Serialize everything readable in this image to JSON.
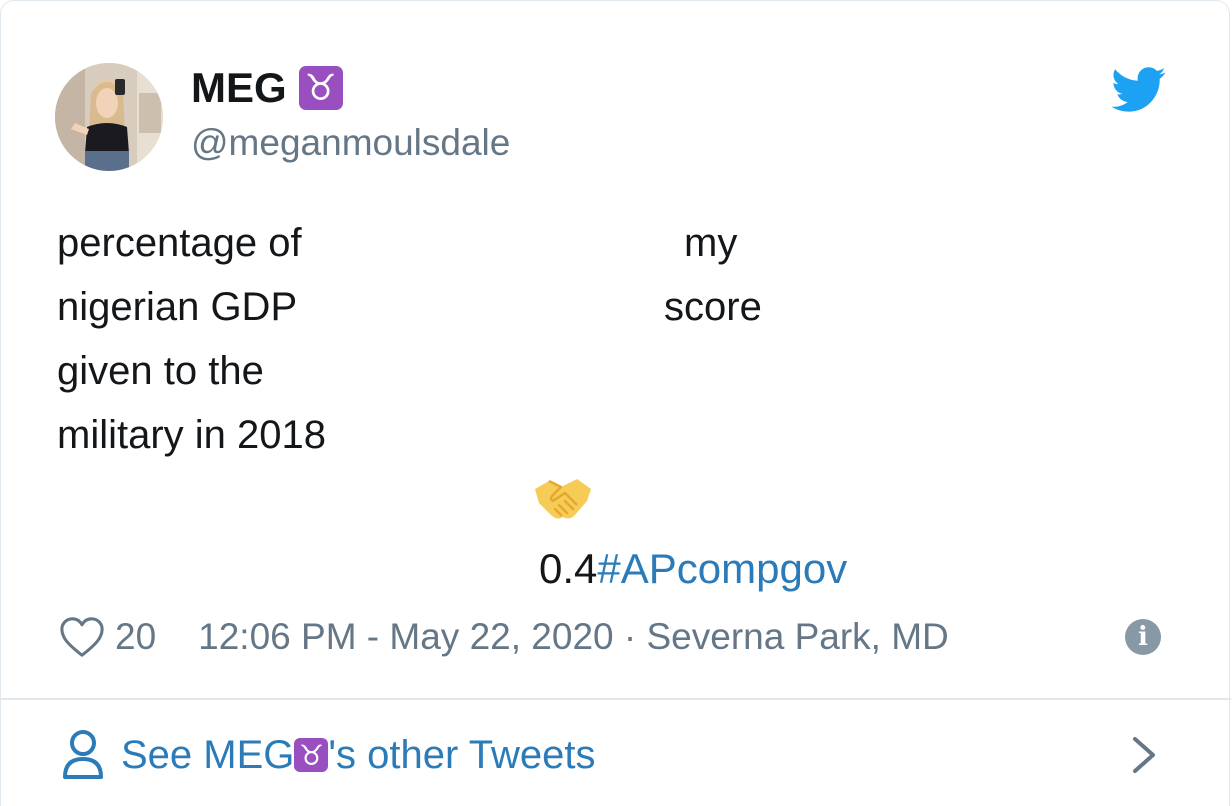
{
  "author": {
    "name": "MEG",
    "zodiac_emoji": "♉",
    "handle": "@meganmoulsdale"
  },
  "tweet": {
    "left_column": [
      "percentage of",
      "nigerian GDP",
      "given to the",
      "military in 2018"
    ],
    "right_column": [
      "my",
      "score"
    ],
    "score_value": "0.4",
    "hashtag": "#APcompgov"
  },
  "meta": {
    "likes": "20",
    "timestamp": "12:06 PM - May 22, 2020 · Severna Park, MD"
  },
  "footer": {
    "prefix": "See MEG ",
    "suffix": "'s other Tweets"
  },
  "icons": {
    "brand": "twitter-bird-icon",
    "like": "heart-outline-icon",
    "info": "info-icon",
    "profile": "person-icon",
    "navigate": "chevron-right-icon",
    "emoji": "handshake-icon"
  },
  "colors": {
    "twitter_blue": "#1da1f2",
    "link_blue": "#2b7bb9",
    "muted_gray": "#657786",
    "zodiac_purple": "#9a4fc0"
  }
}
